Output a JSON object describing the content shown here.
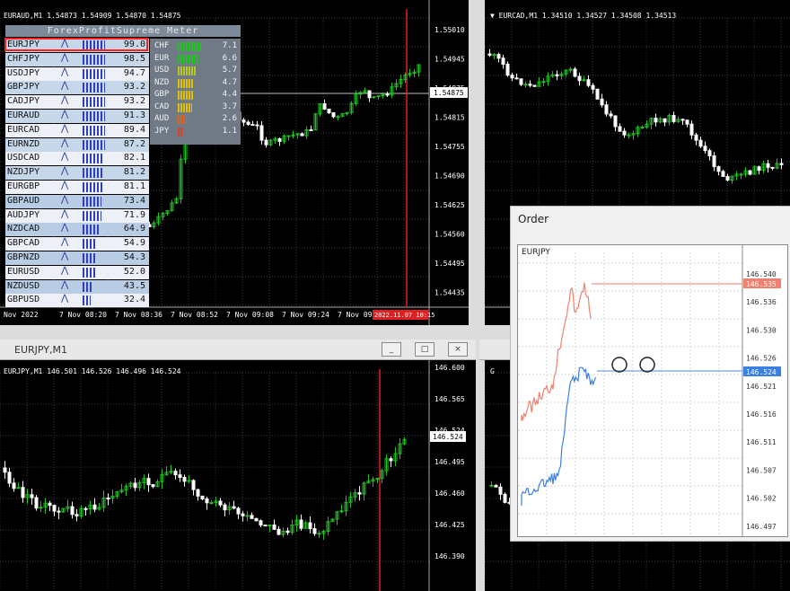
{
  "windows": {
    "eurAud": {
      "symbol": "EURAUD,M1",
      "ohlc": "1.54873 1.54909 1.54870 1.54875",
      "prices": [
        "1.55010",
        "1.54945",
        "1.54875",
        "1.54815",
        "1.54755",
        "1.54690",
        "1.54625",
        "1.54560",
        "1.54495",
        "1.54435"
      ],
      "current_price": "1.54875",
      "times": [
        "Nov 2022",
        "7 Nov 08:20",
        "7 Nov 08:36",
        "7 Nov 08:52",
        "7 Nov 09:08",
        "7 Nov 09:24",
        "7 Nov 09:"
      ],
      "time_highlight": "2022.11.07 10:15"
    },
    "eurCad": {
      "symbol": "EURCAD,M1",
      "ohlc": "1.34510 1.34527 1.34508 1.34513"
    },
    "eurJpy": {
      "title": "EURJPY,M1",
      "symbol": "EURJPY,M1",
      "ohlc": "146.501 146.526 146.496 146.524",
      "prices": [
        "146.600",
        "146.565",
        "146.524",
        "146.495",
        "146.460",
        "146.425",
        "146.390"
      ],
      "current_price": "146.524",
      "buttons": [
        "_",
        "□",
        "×"
      ]
    },
    "fourth": {
      "symbol": "G"
    }
  },
  "meter": {
    "title": "ForexProfitSupreme Meter",
    "pairs": [
      {
        "name": "EURJPY",
        "value": "99.0",
        "bars": 11,
        "bg": "#c6d7ea"
      },
      {
        "name": "CHFJPY",
        "value": "98.5",
        "bars": 11,
        "bg": "#c6d7ea"
      },
      {
        "name": "USDJPY",
        "value": "94.7",
        "bars": 11,
        "bg": "#eef0f8"
      },
      {
        "name": "GBPJPY",
        "value": "93.2",
        "bars": 11,
        "bg": "#c6d7ea"
      },
      {
        "name": "CADJPY",
        "value": "93.2",
        "bars": 11,
        "bg": "#eef0f8"
      },
      {
        "name": "EURAUD",
        "value": "91.3",
        "bars": 11,
        "bg": "#c6d7ea"
      },
      {
        "name": "EURCAD",
        "value": "89.4",
        "bars": 11,
        "bg": "#eef0f8"
      },
      {
        "name": "EURNZD",
        "value": "87.2",
        "bars": 11,
        "bg": "#c6d7ea"
      },
      {
        "name": "USDCAD",
        "value": "82.1",
        "bars": 10,
        "bg": "#eef0f8"
      },
      {
        "name": "NZDJPY",
        "value": "81.2",
        "bars": 10,
        "bg": "#c6d7ea"
      },
      {
        "name": "EURGBP",
        "value": "81.1",
        "bars": 10,
        "bg": "#eef0f8"
      },
      {
        "name": "GBPAUD",
        "value": "73.4",
        "bars": 9,
        "bg": "#b8cde4"
      },
      {
        "name": "AUDJPY",
        "value": "71.9",
        "bars": 9,
        "bg": "#eef0f8"
      },
      {
        "name": "NZDCAD",
        "value": "64.9",
        "bars": 8,
        "bg": "#b8cde4"
      },
      {
        "name": "GBPCAD",
        "value": "54.9",
        "bars": 6,
        "bg": "#eef0f8"
      },
      {
        "name": "GBPNZD",
        "value": "54.3",
        "bars": 6,
        "bg": "#b8cde4"
      },
      {
        "name": "EURUSD",
        "value": "52.0",
        "bars": 6,
        "bg": "#eef0f8"
      },
      {
        "name": "NZDUSD",
        "value": "43.5",
        "bars": 5,
        "bg": "#b8cde4"
      },
      {
        "name": "GBPUSD",
        "value": "32.4",
        "bars": 4,
        "bg": "#eef0f8"
      }
    ],
    "currencies": [
      {
        "name": "CHF",
        "value": "7.1",
        "bars": 10,
        "color": "#22c022"
      },
      {
        "name": "EUR",
        "value": "6.6",
        "bars": 9,
        "color": "#22c022"
      },
      {
        "name": "USD",
        "value": "5.7",
        "bars": 8,
        "color": "#b8c820"
      },
      {
        "name": "NZD",
        "value": "4.7",
        "bars": 7,
        "color": "#e0c000"
      },
      {
        "name": "GBP",
        "value": "4.4",
        "bars": 7,
        "color": "#e0c000"
      },
      {
        "name": "CAD",
        "value": "3.7",
        "bars": 6,
        "color": "#e0c000"
      },
      {
        "name": "AUD",
        "value": "2.6",
        "bars": 4,
        "color": "#e06020"
      },
      {
        "name": "JPY",
        "value": "1.1",
        "bars": 2,
        "color": "#e04020"
      }
    ],
    "highlight_color": "#ff2020"
  },
  "order": {
    "title": "Order",
    "symbol": "EURJPY",
    "prices": [
      "146.540",
      "146.536",
      "146.530",
      "146.526",
      "146.521",
      "146.516",
      "146.511",
      "146.507",
      "146.502",
      "146.497"
    ],
    "ask_price": "146.535",
    "bid_price": "146.524",
    "ask_color": "#f08070",
    "bid_color": "#3a80e0"
  },
  "colors": {
    "bull": "#22c022",
    "bear": "#ffffff",
    "grid": "#3a3a3a",
    "text": "#ffffff",
    "marker": "#e02020"
  }
}
